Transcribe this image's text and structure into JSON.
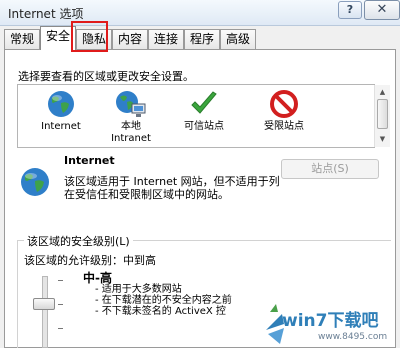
{
  "window": {
    "title": "Internet 选项",
    "help_label": "?",
    "close_label": "✕"
  },
  "tabs": [
    {
      "label": "常规",
      "active": false
    },
    {
      "label": "安全",
      "active": true
    },
    {
      "label": "隐私",
      "active": false
    },
    {
      "label": "内容",
      "active": false
    },
    {
      "label": "连接",
      "active": false
    },
    {
      "label": "程序",
      "active": false
    },
    {
      "label": "高级",
      "active": false
    }
  ],
  "security": {
    "instruction": "选择要查看的区域或更改安全设置。",
    "zones": [
      {
        "label": "Internet",
        "icon": "globe-icon"
      },
      {
        "label": "本地\nIntranet",
        "icon": "intranet-icon"
      },
      {
        "label": "可信站点",
        "icon": "checkmark-icon"
      },
      {
        "label": "受限站点",
        "icon": "restricted-icon"
      }
    ],
    "selected_zone": {
      "name": "Internet",
      "description": "该区域适用于 Internet 网站，但不适用于列在受信任和受限制区域中的网站。",
      "sites_button": "站点(S)"
    },
    "level": {
      "legend": "该区域的安全级别(L)",
      "allowed": "该区域的允许级别：中到高",
      "name": "中-高",
      "bullets": [
        "- 适用于大多数网站",
        "- 在下载潜在的不安全内容之前",
        "- 不下载未签名的 ActiveX 控"
      ]
    }
  },
  "watermark": {
    "brand": "win7下载吧",
    "url": "www.8495.com"
  },
  "colors": {
    "highlight": "#e01b1b",
    "watermark": "#2f7fb8"
  }
}
